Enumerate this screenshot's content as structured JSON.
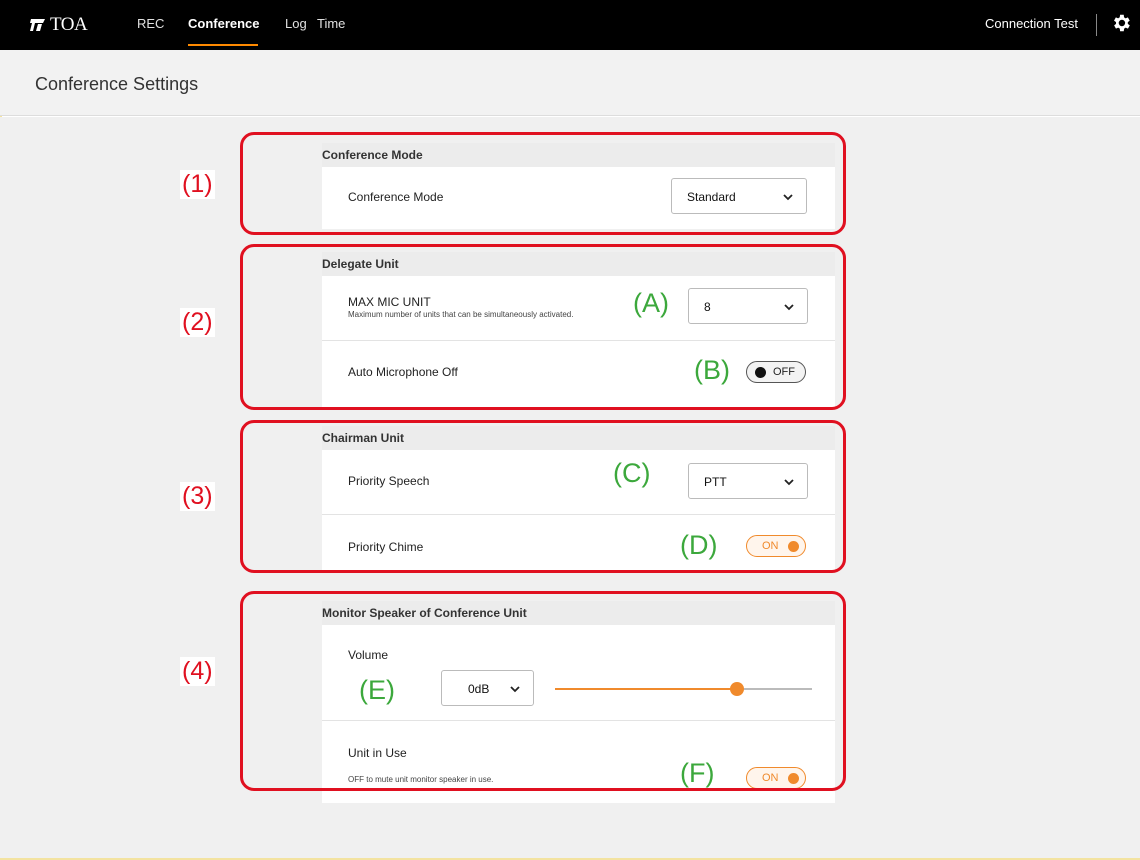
{
  "app": {
    "logo_text": "TOA",
    "nav": [
      "REC",
      "Conference",
      "Log",
      "Time"
    ],
    "active_nav": "Conference",
    "connection_test": "Connection Test"
  },
  "page": {
    "title": "Conference Settings"
  },
  "sections": {
    "conference_mode": {
      "header": "Conference Mode",
      "label": "Conference Mode",
      "value": "Standard"
    },
    "delegate_unit": {
      "header": "Delegate Unit",
      "max_mic_label": "MAX MIC UNIT",
      "max_mic_desc": "Maximum number of units that can be simultaneously activated.",
      "max_mic_value": "8",
      "auto_off_label": "Auto Microphone Off",
      "auto_off_state": "OFF"
    },
    "chairman_unit": {
      "header": "Chairman Unit",
      "priority_speech_label": "Priority Speech",
      "priority_speech_value": "PTT",
      "priority_chime_label": "Priority Chime",
      "priority_chime_state": "ON"
    },
    "monitor_speaker": {
      "header": "Monitor Speaker of Conference Unit",
      "volume_label": "Volume",
      "volume_value": "0dB",
      "volume_slider_fraction": 0.71,
      "unit_in_use_label": "Unit in Use",
      "unit_in_use_desc": "OFF to mute unit monitor speaker in use.",
      "unit_in_use_state": "ON"
    }
  },
  "annotations": {
    "numbers": [
      "(1)",
      "(2)",
      "(3)",
      "(4)"
    ],
    "letters": [
      "(A)",
      "(B)",
      "(C)",
      "(D)",
      "(E)",
      "(F)"
    ]
  },
  "colors": {
    "accent": "#f08a2c",
    "annotation_red": "#e01020",
    "annotation_green": "#3ca83c"
  }
}
